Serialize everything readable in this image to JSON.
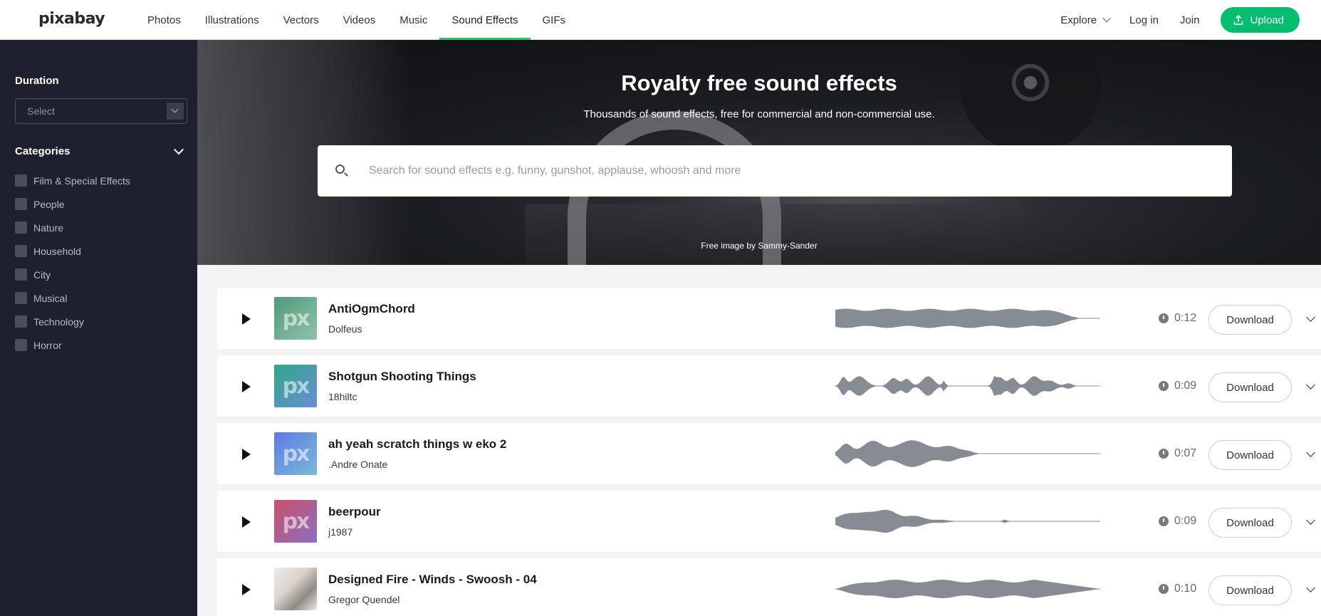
{
  "brand": {
    "logo": "pixabay"
  },
  "nav": {
    "items": [
      {
        "label": "Photos",
        "active": false
      },
      {
        "label": "Illustrations",
        "active": false
      },
      {
        "label": "Vectors",
        "active": false
      },
      {
        "label": "Videos",
        "active": false
      },
      {
        "label": "Music",
        "active": false
      },
      {
        "label": "Sound Effects",
        "active": true
      },
      {
        "label": "GIFs",
        "active": false
      }
    ],
    "explore": "Explore",
    "login": "Log in",
    "join": "Join",
    "upload": "Upload"
  },
  "sidebar": {
    "duration_heading": "Duration",
    "duration_select": "Select",
    "categories_heading": "Categories",
    "categories": [
      "Film & Special Effects",
      "People",
      "Nature",
      "Household",
      "City",
      "Musical",
      "Technology",
      "Horror"
    ]
  },
  "hero": {
    "title": "Royalty free sound effects",
    "subtitle": "Thousands of sound effects, free for commercial and non-commercial use.",
    "search_placeholder": "Search for sound effects e.g. funny, gunshot, applause, whoosh and more",
    "credit": "Free image by Sammy-Sander"
  },
  "tracks": [
    {
      "title": "AntiOgmChord",
      "author": "Dolfeus",
      "duration": "0:12",
      "download": "Download",
      "thumb_text": "px",
      "thumb_colors": [
        "#4e9a7a",
        "#8fc3a9"
      ],
      "wave": "sustain"
    },
    {
      "title": "Shotgun Shooting Things",
      "author": "18hiltc",
      "duration": "0:09",
      "download": "Download",
      "thumb_text": "px",
      "thumb_colors": [
        "#2fa889",
        "#6a8ed6"
      ],
      "wave": "bursts"
    },
    {
      "title": "ah yeah scratch things w eko 2",
      "author": ".Andre Onate",
      "duration": "0:07",
      "download": "Download",
      "thumb_text": "px",
      "thumb_colors": [
        "#5d7ae6",
        "#7bb9d8"
      ],
      "wave": "front"
    },
    {
      "title": "beerpour",
      "author": "j1987",
      "duration": "0:09",
      "download": "Download",
      "thumb_text": "px",
      "thumb_colors": [
        "#cf4f6a",
        "#8a6fc0"
      ],
      "wave": "small"
    },
    {
      "title": "Designed Fire - Winds - Swoosh - 04",
      "author": "Gregor Quendel",
      "duration": "0:10",
      "download": "Download",
      "thumb_text": "",
      "thumb_colors": [],
      "wave": "swoosh"
    }
  ],
  "colors": {
    "accent": "#02be6e",
    "sidebar_bg": "#1e2030",
    "waveform": "#878c93"
  }
}
